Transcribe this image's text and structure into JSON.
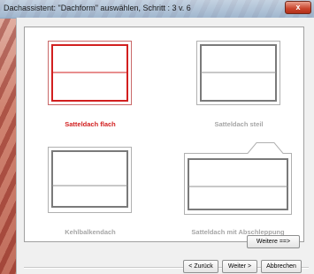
{
  "window": {
    "title": "Dachassistent: \"Dachform\" auswählen, Schritt : 3 v. 6",
    "close_glyph": "x"
  },
  "options": [
    {
      "label": "Satteldach flach",
      "selected": true
    },
    {
      "label": "Satteldach steil",
      "selected": false
    },
    {
      "label": "Kehlbalkendach",
      "selected": false
    },
    {
      "label": "Satteldach mit Abschleppung",
      "selected": false
    }
  ],
  "buttons": {
    "more": "Weitere ==>",
    "back": "< Zurück",
    "next": "Weiter >",
    "cancel": "Abbrechen"
  },
  "colors": {
    "selected": "#d21f1f",
    "unselected_text": "#a6a6a6",
    "frame": "#808080"
  }
}
